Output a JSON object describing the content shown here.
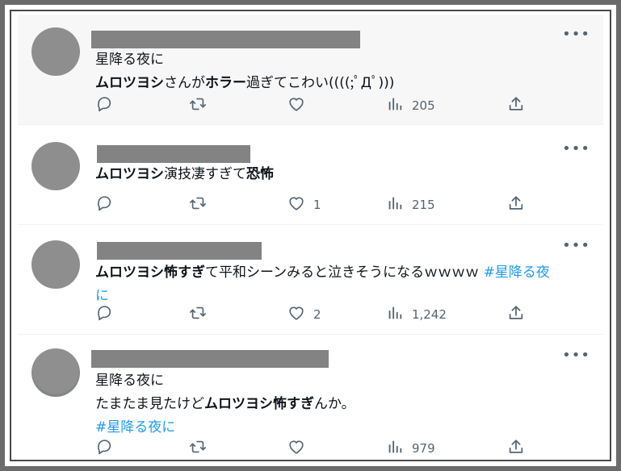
{
  "tweets": [
    {
      "name": "",
      "lines": [
        [
          {
            "t": "星降る夜に"
          }
        ],
        [
          {
            "t": "ムロツヨシ",
            "b": true
          },
          {
            "t": "さんが"
          },
          {
            "t": "ホラー",
            "b": true
          },
          {
            "t": "過ぎてこわい((((;ﾟДﾟ)))"
          }
        ]
      ],
      "counts": {
        "reply": "",
        "retweet": "",
        "like": "",
        "views": "205"
      }
    },
    {
      "name": "",
      "lines": [
        [
          {
            "t": "ムロツヨシ",
            "b": true
          },
          {
            "t": "演技凄すぎて"
          },
          {
            "t": "恐怖",
            "b": true
          }
        ]
      ],
      "counts": {
        "reply": "",
        "retweet": "",
        "like": "1",
        "views": "215"
      }
    },
    {
      "name": "",
      "lines": [
        [
          {
            "t": "ムロツヨシ怖すぎ",
            "b": true
          },
          {
            "t": "て平和シーンみると泣きそうになるｗｗｗｗ "
          },
          {
            "t": "#星降る夜",
            "tag": true
          }
        ],
        [
          {
            "t": "に",
            "tag": true
          }
        ]
      ],
      "counts": {
        "reply": "",
        "retweet": "",
        "like": "2",
        "views": "1,242"
      }
    },
    {
      "name": "",
      "lines": [
        [
          {
            "t": "星降る夜に"
          }
        ],
        [
          {
            "t": "たまたま見たけど"
          },
          {
            "t": "ムロツヨシ怖すぎ",
            "b": true
          },
          {
            "t": "んか。"
          }
        ],
        [
          {
            "t": "#星降る夜に",
            "tag": true
          }
        ]
      ],
      "counts": {
        "reply": "",
        "retweet": "",
        "like": "",
        "views": "979"
      }
    }
  ],
  "icons": {
    "more": "more-horizontal-icon",
    "reply": "reply-icon",
    "retweet": "retweet-icon",
    "like": "like-icon",
    "views": "views-icon",
    "share": "share-icon"
  },
  "colors": {
    "hashtag": "#1d9bf0",
    "text": "#0f1419",
    "muted": "#536471",
    "highlight_bg": "#f7f7f7"
  }
}
